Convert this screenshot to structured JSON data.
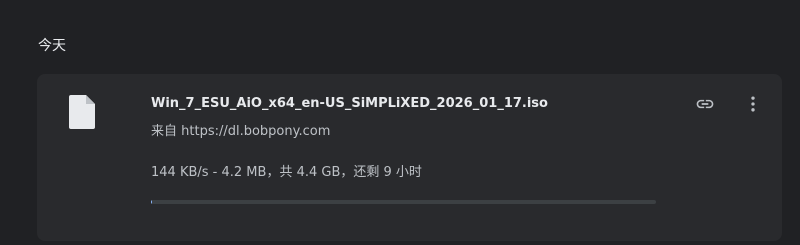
{
  "section": {
    "title": "今天"
  },
  "download": {
    "filename": "Win_7_ESU_AiO_x64_en-US_SiMPLiXED_2026_01_17.iso",
    "source": "来自 https://dl.bobpony.com",
    "status": "144 KB/s - 4.2 MB，共 4.4 GB，还剩 9 小时",
    "progress_fraction": 0.001,
    "icons": {
      "file": "file-icon",
      "copy_link": "link-icon",
      "more": "more-vert-icon"
    }
  },
  "colors": {
    "background": "#202124",
    "card": "#292a2d",
    "text_primary": "#e8eaed",
    "text_secondary": "#bdc1c6",
    "progress_track": "#3c4043",
    "progress_fill": "#8ab4f8"
  }
}
